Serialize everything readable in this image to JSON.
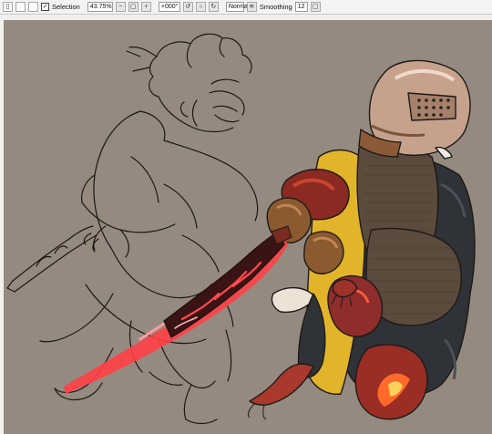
{
  "toolbar": {
    "selection_label": "Selection",
    "selection_checked": true,
    "zoom_value": "43.75%",
    "rotation_value": "+000°",
    "blend_mode": "Normal",
    "smoothing_label": "Smoothing",
    "smoothing_value": "12",
    "icons": {
      "new": "new-document-icon",
      "open": "open-icon",
      "save": "save-icon",
      "zoom_out": "zoom-out-icon",
      "zoom_fit": "zoom-fit-icon",
      "zoom_in": "zoom-in-icon",
      "rotate_ccw": "rotate-ccw-icon",
      "rotate_reset": "rotate-reset-icon",
      "rotate_cw": "rotate-cw-icon",
      "stabilizer": "stabilizer-icon"
    }
  },
  "canvas": {
    "background_color": "#958a80",
    "artwork": "sketch-and-armored-figure"
  }
}
